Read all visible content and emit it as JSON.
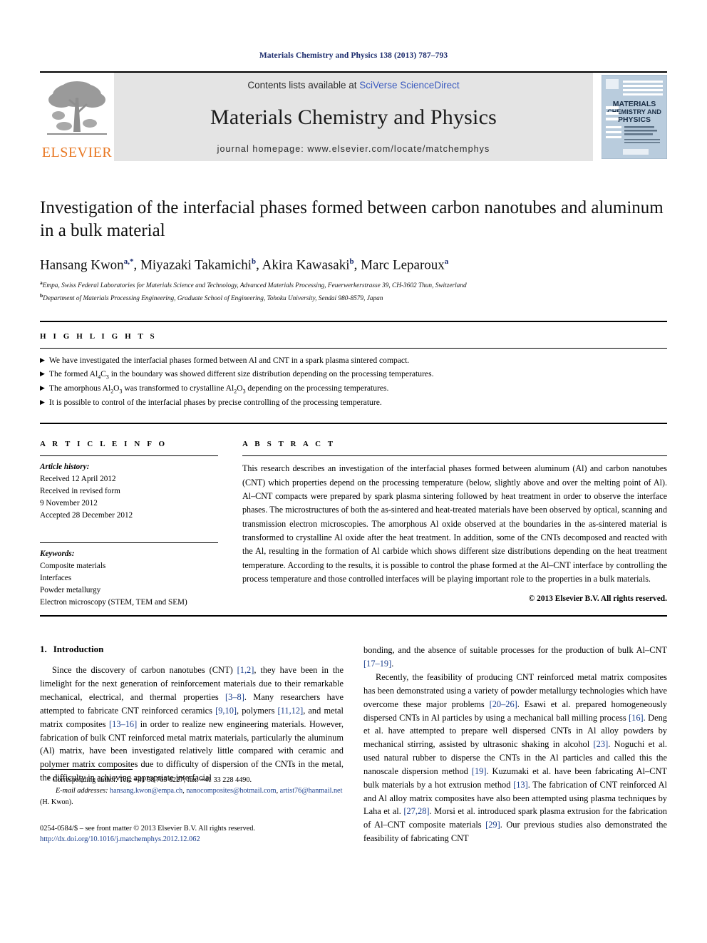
{
  "running_head": "Materials Chemistry and Physics 138 (2013) 787–793",
  "masthead": {
    "contents_prefix": "Contents lists available at ",
    "sciencedirect_link": "SciVerse ScienceDirect",
    "journal_name": "Materials Chemistry and Physics",
    "homepage": "journal homepage: www.elsevier.com/locate/matchemphys",
    "publisher_wordmark": "ELSEVIER",
    "publisher_color": "#E87722",
    "link_color": "#3b5bbf",
    "band_color": "#e4e4e4",
    "cover": {
      "line1": "MATERIALS",
      "line2": "CHEMISTRY AND",
      "line3": "PHYSICS",
      "bg_color": "#b9ccdd"
    }
  },
  "title": "Investigation of the interfacial phases formed between carbon nanotubes and aluminum in a bulk material",
  "authors_html": "Hansang Kwon<sup>a,*</sup>, Miyazaki Takamichi<sup>b</sup>, Akira Kawasaki<sup>b</sup>, Marc Leparoux<sup>a</sup>",
  "affiliations": [
    "Empa, Swiss Federal Laboratories for Materials Science and Technology, Advanced Materials Processing, Feuerwerkerstrasse 39, CH-3602 Thun, Switzerland",
    "Department of Materials Processing Engineering, Graduate School of Engineering, Tohoku University, Sendai 980-8579, Japan"
  ],
  "affiliation_marks": [
    "a",
    "b"
  ],
  "highlights": {
    "heading": "H I G H L I G H T S",
    "bullet_glyph": "▶",
    "items_html": [
      "We have investigated the interfacial phases formed between Al and CNT in a spark plasma sintered compact.",
      "The formed Al<sub>4</sub>C<sub>3</sub> in the boundary was showed different size distribution depending on the processing temperatures.",
      "The amorphous Al<sub>2</sub>O<sub>3</sub> was transformed to crystalline Al<sub>2</sub>O<sub>3</sub> depending on the processing temperatures.",
      "It is possible to control of the interfacial phases by precise controlling of the processing temperature."
    ]
  },
  "article_info": {
    "heading": "A R T I C L E  I N F O",
    "history_label": "Article history:",
    "history_lines": [
      "Received 12 April 2012",
      "Received in revised form",
      "9 November 2012",
      "Accepted 28 December 2012"
    ],
    "keywords_label": "Keywords:",
    "keywords": [
      "Composite materials",
      "Interfaces",
      "Powder metallurgy",
      "Electron microscopy (STEM, TEM and SEM)"
    ]
  },
  "abstract": {
    "heading": "A B S T R A C T",
    "text": "This research describes an investigation of the interfacial phases formed between aluminum (Al) and carbon nanotubes (CNT) which properties depend on the processing temperature (below, slightly above and over the melting point of Al). Al–CNT compacts were prepared by spark plasma sintering followed by heat treatment in order to observe the interface phases. The microstructures of both the as-sintered and heat-treated materials have been observed by optical, scanning and transmission electron microscopies. The amorphous Al oxide observed at the boundaries in the as-sintered material is transformed to crystalline Al oxide after the heat treatment. In addition, some of the CNTs decomposed and reacted with the Al, resulting in the formation of Al carbide which shows different size distributions depending on the heat treatment temperature. According to the results, it is possible to control the phase formed at the Al–CNT interface by controlling the process temperature and those controlled interfaces will be playing important role to the properties in a bulk materials.",
    "copyright": "© 2013 Elsevier B.V. All rights reserved."
  },
  "body": {
    "section_number": "1.",
    "section_title": "Introduction",
    "left_paragraph_html": "Since the discovery of carbon nanotubes (CNT) <span class=\"ref\">[1,2]</span>, they have been in the limelight for the next generation of reinforcement materials due to their remarkable mechanical, electrical, and thermal properties <span class=\"ref\">[3–8]</span>. Many researchers have attempted to fabricate CNT reinforced ceramics <span class=\"ref\">[9,10]</span>, polymers <span class=\"ref\">[11,12]</span>, and metal matrix composites <span class=\"ref\">[13–16]</span> in order to realize new engineering materials. However, fabrication of bulk CNT reinforced metal matrix materials, particularly the aluminum (Al) matrix, have been investigated relatively little compared with ceramic and polymer matrix composites due to difficulty of dispersion of the CNTs in the metal, the difficulty in achieving appropriate interfacial",
    "right_paragraph_1_html": "bonding, and the absence of suitable processes for the production of bulk Al–CNT <span class=\"ref\">[17–19]</span>.",
    "right_paragraph_2_html": "Recently, the feasibility of producing CNT reinforced metal matrix composites has been demonstrated using a variety of powder metallurgy technologies which have overcome these major problems <span class=\"ref\">[20–26]</span>. Esawi et al. prepared homogeneously dispersed CNTs in Al particles by using a mechanical ball milling process <span class=\"ref\">[16]</span>. Deng et al. have attempted to prepare well dispersed CNTs in Al alloy powders by mechanical stirring, assisted by ultrasonic shaking in alcohol <span class=\"ref\">[23]</span>. Noguchi et al. used natural rubber to disperse the CNTs in the Al particles and called this the nanoscale dispersion method <span class=\"ref\">[19]</span>. Kuzumaki et al. have been fabricating Al–CNT bulk materials by a hot extrusion method <span class=\"ref\">[13]</span>. The fabrication of CNT reinforced Al and Al alloy matrix composites have also been attempted using plasma techniques by Laha et al. <span class=\"ref\">[27,28]</span>. Morsi et al. introduced spark plasma extrusion for the fabrication of Al–CNT composite materials <span class=\"ref\">[29]</span>. Our previous studies also demonstrated the feasibility of fabricating CNT"
  },
  "footnote": {
    "corresponding_html": "* Corresponding author. Tel.: +41 58 765 6227; fax: +41 33 228 4490.",
    "email_html": "<span class=\"fn-em\">E-mail addresses:</span> <span class=\"fn-link\">hansang.kwon@empa.ch</span>, <span class=\"fn-link\">nanocomposites@hotmail.com</span>, <span class=\"fn-link\">artist76@hanmail.net</span> (H. Kwon).",
    "imprint_line1_html": "0254-0584/$ – see front matter © 2013 Elsevier B.V. All rights reserved.",
    "imprint_doi": "http://dx.doi.org/10.1016/j.matchemphys.2012.12.062"
  }
}
